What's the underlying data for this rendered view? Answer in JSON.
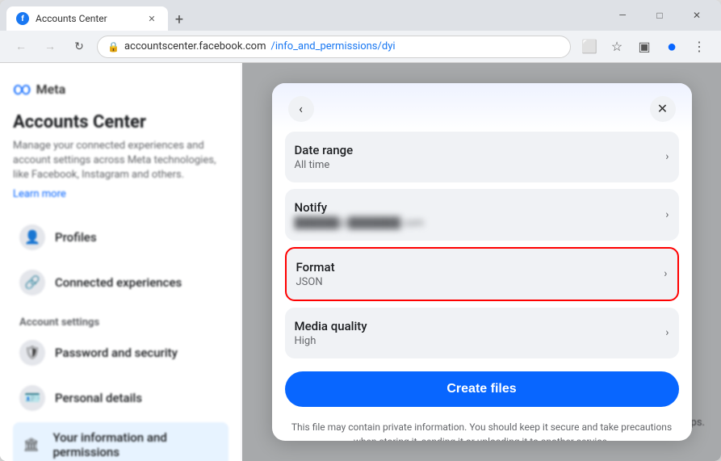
{
  "browser": {
    "tab_title": "Accounts Center",
    "tab_favicon": "f",
    "url_prefix": "accountscenter.facebook.com",
    "url_path": "/info_and_permissions/dyi",
    "new_tab_label": "+",
    "minimize_icon": "—",
    "restore_icon": "□",
    "close_icon": "✕",
    "back_icon": "←",
    "forward_icon": "→",
    "refresh_icon": "↻",
    "cast_icon": "⬜",
    "bookmark_icon": "☆",
    "sidebar_icon": "▣",
    "profile_icon": "●",
    "menu_icon": "⋮"
  },
  "sidebar": {
    "meta_logo": "∞ Meta",
    "title": "Accounts Center",
    "description": "Manage your connected experiences and account settings across Meta technologies, like Facebook, Instagram and others.",
    "learn_more": "Learn more",
    "nav_items": [
      {
        "id": "profiles",
        "label": "Profiles",
        "icon": "👤"
      },
      {
        "id": "connected",
        "label": "Connected experiences",
        "icon": "🔗"
      }
    ],
    "account_settings_heading": "Account settings",
    "settings_items": [
      {
        "id": "password",
        "label": "Password and security",
        "icon": "🛡"
      },
      {
        "id": "personal",
        "label": "Personal details",
        "icon": "🪪"
      },
      {
        "id": "your_info",
        "label": "Your information and permissions",
        "icon": "🏛"
      }
    ]
  },
  "modal": {
    "back_icon": "‹",
    "close_icon": "✕",
    "items": [
      {
        "id": "date_range",
        "label": "Date range",
        "value": "All time",
        "chevron": "›",
        "highlighted": false,
        "value_blurred": false
      },
      {
        "id": "notify",
        "label": "Notify",
        "value": "——@———.com",
        "chevron": "›",
        "highlighted": false,
        "value_blurred": true
      },
      {
        "id": "format",
        "label": "Format",
        "value": "JSON",
        "chevron": "›",
        "highlighted": true,
        "value_blurred": false
      },
      {
        "id": "media_quality",
        "label": "Media quality",
        "value": "High",
        "chevron": "›",
        "highlighted": false,
        "value_blurred": false
      }
    ],
    "create_button": "Create files",
    "disclaimer": "This file may contain private information. You should keep it secure and take precautions when storing it, sending it or uploading it to another service."
  },
  "bg": {
    "apps_text": "r apps."
  }
}
